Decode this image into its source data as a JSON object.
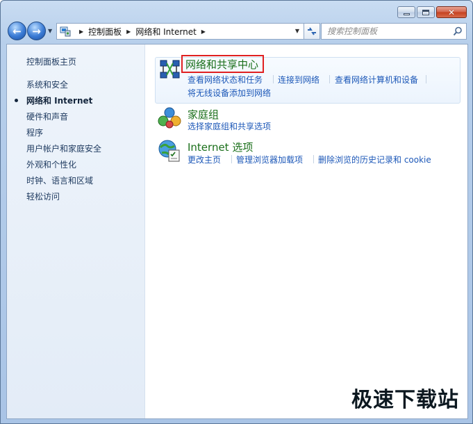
{
  "window": {
    "caption_buttons": {
      "minimize": "minimize",
      "maximize": "maximize",
      "close": "✕"
    }
  },
  "nav": {
    "breadcrumb": [
      "控制面板",
      "网络和 Internet"
    ],
    "search_placeholder": "搜索控制面板"
  },
  "sidebar": {
    "items": [
      {
        "label": "控制面板主页",
        "active": false
      },
      {
        "label": "系统和安全",
        "active": false
      },
      {
        "label": "网络和 Internet",
        "active": true
      },
      {
        "label": "硬件和声音",
        "active": false
      },
      {
        "label": "程序",
        "active": false
      },
      {
        "label": "用户帐户和家庭安全",
        "active": false
      },
      {
        "label": "外观和个性化",
        "active": false
      },
      {
        "label": "时钟、语言和区域",
        "active": false
      },
      {
        "label": "轻松访问",
        "active": false
      }
    ]
  },
  "categories": [
    {
      "title": "网络和共享中心",
      "icon": "network-sharing-icon",
      "tasks": [
        "查看网络状态和任务",
        "连接到网络",
        "查看网络计算机和设备",
        "将无线设备添加到网络"
      ]
    },
    {
      "title": "家庭组",
      "icon": "homegroup-icon",
      "tasks": [
        "选择家庭组和共享选项"
      ]
    },
    {
      "title": "Internet 选项",
      "icon": "internet-options-icon",
      "tasks": [
        "更改主页",
        "管理浏览器加载项",
        "删除浏览的历史记录和 cookie"
      ]
    }
  ],
  "watermark": "极速下载站",
  "colors": {
    "link": "#1d58b8",
    "category_title": "#1a6f1a",
    "highlight_border": "#e02020"
  }
}
